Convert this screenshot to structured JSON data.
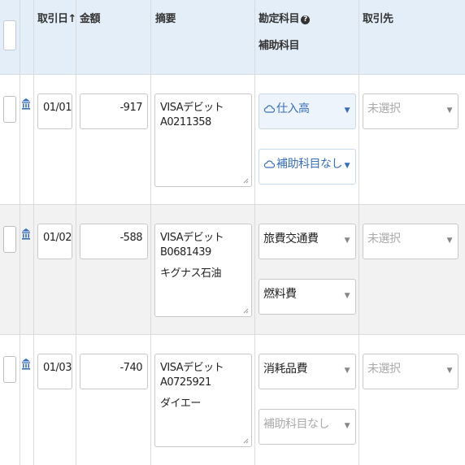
{
  "header": {
    "date": "取引日",
    "sort_arrow": "↑",
    "amount": "金額",
    "memo": "摘要",
    "account": "勘定科目",
    "help": "?",
    "subaccount": "補助科目",
    "partner": "取引先"
  },
  "rows": [
    {
      "date": "01/01",
      "amount": "-917",
      "memo_line1": "VISAデビット A0211358",
      "memo_line2": "",
      "account": "仕入高",
      "subaccount": "補助科目なし",
      "partner": "未選択"
    },
    {
      "date": "01/02",
      "amount": "-588",
      "memo_line1": "VISAデビット B0681439",
      "memo_line2": "キグナス石油",
      "account": "旅費交通費",
      "subaccount": "燃料費",
      "partner": "未選択"
    },
    {
      "date": "01/03",
      "amount": "-740",
      "memo_line1": "VISAデビット A0725921",
      "memo_line2": "ダイエー",
      "account": "消耗品費",
      "subaccount": "補助科目なし",
      "partner": "未選択"
    }
  ],
  "colors": {
    "header_bg": "#e4eef8",
    "alt_row_bg": "#f2f2f2",
    "accent_blue": "#3a6fb5",
    "ai_suggest_bg": "#eef4fc"
  },
  "icons": {
    "bank": "bank-icon",
    "cloud": "cloud-icon",
    "dropdown": "caret-down-icon"
  }
}
